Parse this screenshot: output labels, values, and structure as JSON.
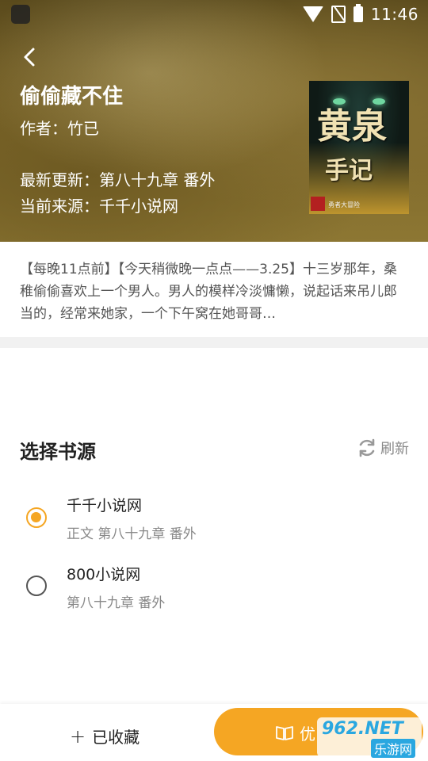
{
  "status_bar": {
    "time": "11:46"
  },
  "book": {
    "title": "偷偷藏不住",
    "author": "作者：竹已",
    "latest_update": "最新更新：第八十九章 番外",
    "current_source": "当前来源：千千小说网",
    "cover": {
      "big_text": "黄泉",
      "sub_text": "手记",
      "small_text": "勇者大冒险"
    },
    "description": "【每晚11点前】【今天稍微晚一点点——3.25】十三岁那年，桑稚偷偷喜欢上一个男人。男人的模样冷淡慵懒，说起话来吊儿郎当的，经常来她家，一个下午窝在她哥哥…"
  },
  "sources": {
    "title": "选择书源",
    "refresh_label": "刷新",
    "items": [
      {
        "name": "千千小说网",
        "chapter": "正文 第八十九章 番外",
        "selected": true
      },
      {
        "name": "800小说网",
        "chapter": "第八十九章 番外",
        "selected": false
      }
    ]
  },
  "actions": {
    "favorite_label": "已收藏",
    "read_label": "优"
  },
  "watermark": {
    "top": "962.NET",
    "bottom": "乐游网"
  },
  "colors": {
    "accent": "#f5a623",
    "text_dark": "#222222",
    "text_gray": "#888888"
  }
}
